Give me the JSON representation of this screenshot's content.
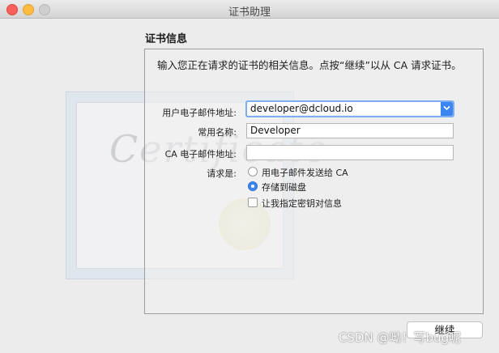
{
  "window": {
    "title": "证书助理"
  },
  "section": {
    "title": "证书信息"
  },
  "description": "输入您正在请求的证书的相关信息。点按“继续”以从 CA 请求证书。",
  "form": {
    "email_label": "用户电子邮件地址:",
    "email_value": "developer@dcloud.io",
    "common_name_label": "常用名称:",
    "common_name_value": "Developer",
    "ca_email_label": "CA 电子邮件地址:",
    "ca_email_value": "",
    "request_label": "请求是:",
    "option_email_ca": "用电子邮件发送给 CA",
    "option_save_disk": "存储到磁盘",
    "option_specify_key": "让我指定密钥对信息",
    "selected_option": "存储到磁盘"
  },
  "background": {
    "certificate_text": "Certificate"
  },
  "buttons": {
    "continue": "继续"
  },
  "watermark": "CSDN @呦！写bug呢",
  "colors": {
    "accent": "#3b86f1",
    "close": "#fc605c",
    "minimize": "#fdbc40"
  }
}
